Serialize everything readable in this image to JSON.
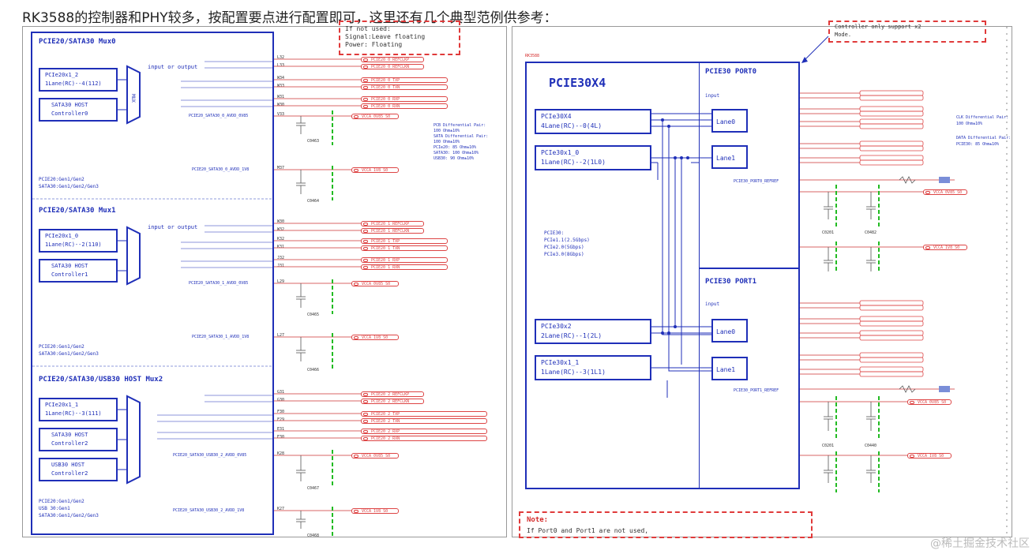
{
  "heading": "RK3588的控制器和PHY较多，按配置要点进行配置即可，这里还有几个典型范例供参考：",
  "watermark": "@稀土掘金技术社区",
  "left": {
    "note_lines": [
      "If not used:",
      "Signal:Leave floating",
      "Power: Floating"
    ],
    "mux0": {
      "title": "PCIE20/SATA30 Mux0",
      "io": "input or output",
      "ctrl_a": [
        "PCIe20x1_2",
        "1Lane(RC)--4(112)"
      ],
      "ctrl_b": [
        "SATA30 HOST",
        "Controller0"
      ],
      "mux_label": "MUX",
      "modes": [
        "PCIE20:Gen1/Gen2",
        "SATA30:Gen1/Gen2/Gen3"
      ],
      "pins": [
        "L32",
        "L33",
        "W34",
        "W33",
        "W31",
        "W30",
        "V33",
        "M37"
      ],
      "nets": [
        "PCIE20_0_REFCLKP",
        "PCIE20_0_REFCLKN",
        "PCIE20_0_TXP",
        "PCIE20_0_TXN",
        "PCIE20_0_RXP",
        "PCIE20_0_RXN"
      ],
      "power_nets": [
        "VCCA_0V85_S0",
        "VCCA_1V8_S0"
      ],
      "power_pins": [
        "PCIE20_SATA30_0_AVDD_0V85",
        "PCIE20_SATA30_0_AVDD_1V8"
      ],
      "caps": [
        "C0463",
        "C0464"
      ]
    },
    "mux1": {
      "title": "PCIE20/SATA30 Mux1",
      "io": "input or output",
      "ctrl_a": [
        "PCIe20x1_0",
        "1Lane(RC)--2(110)"
      ],
      "ctrl_b": [
        "SATA30 HOST",
        "Controller1"
      ],
      "mux_label": "MUX",
      "modes": [
        "PCIE20:Gen1/Gen2",
        "SATA30:Gen1/Gen2/Gen3"
      ],
      "pins": [
        "W30",
        "W32",
        "K32",
        "K31",
        "J32",
        "J31",
        "L29",
        "L27"
      ],
      "nets": [
        "PCIE20_1_REFCLKP",
        "PCIE20_1_REFCLKN",
        "PCIE20_1_TXP",
        "PCIE20_1_TXN",
        "PCIE20_1_RXP",
        "PCIE20_1_RXN"
      ],
      "power_nets": [
        "VCCA_0V85_S0",
        "VCCA_1V8_S0"
      ],
      "power_pins": [
        "PCIE20_SATA30_1_AVDD_0V85",
        "PCIE20_SATA30_1_AVDD_1V8"
      ],
      "caps": [
        "C0465",
        "C0466"
      ]
    },
    "mux2": {
      "title": "PCIE20/SATA30/USB30 HOST Mux2",
      "ctrl_a": [
        "PCIe20x1_1",
        "1Lane(RC)--3(111)"
      ],
      "ctrl_b": [
        "SATA30 HOST",
        "Controller2"
      ],
      "ctrl_c": [
        "USB30 HOST",
        "Controller2"
      ],
      "mux_label": "MUX",
      "modes": [
        "PCIE20:Gen1/Gen2",
        "USB 30:Gen1",
        "SATA30:Gen1/Gen2/Gen3"
      ],
      "pins": [
        "G31",
        "G30",
        "F30",
        "F29",
        "E31",
        "E30",
        "K28",
        "K27"
      ],
      "nets": [
        "PCIE20_2_REFCLKP",
        "PCIE20_2_REFCLKN",
        "PCIE20_2_TXP",
        "PCIE20_2_TXN",
        "PCIE20_2_RXP",
        "PCIE20_2_RXN"
      ],
      "power_nets": [
        "VCCA_0V85_S0",
        "VCCA_1V8_S0"
      ],
      "power_pins": [
        "PCIE20_SATA30_USB30_2_AVDD_0V85",
        "PCIE20_SATA30_USB30_2_AVDD_1V8"
      ],
      "caps": [
        "C0467",
        "C0468"
      ]
    },
    "side_note": [
      "PCB Differential Pair:",
      "100 Ohm±10%",
      "SATA Differential Pair:",
      "100 Ohm±10%",
      "PCIe20: 85 Ohm±10%",
      "SATA30: 100 Ohm±10%",
      "USB30: 90 Ohm±10%"
    ]
  },
  "right": {
    "top_note": [
      "Controller only support x2",
      "Mode."
    ],
    "block_title": "PCIE30X4",
    "port0_title": "PCIE30 PORT0",
    "port1_title": "PCIE30 PORT1",
    "ctrl0": [
      "PCIe30X4",
      "4Lane(RC)--0(4L)"
    ],
    "ctrl1": [
      "PCIe30x1_0",
      "1Lane(RC)--2(1L0)"
    ],
    "ctrl2": [
      "PCIe30x2",
      "2Lane(RC)--1(2L)"
    ],
    "ctrl3": [
      "PCIe30x1_1",
      "1Lane(RC)--3(1L1)"
    ],
    "lanes": [
      "Lane0",
      "Lane1",
      "Lane0",
      "Lane1"
    ],
    "speeds": [
      "PCIE30:",
      "PCIe1.1(2.5Gbps)",
      "PCIe2.0(5Gbps)",
      "PCIe3.0(8Gbps)"
    ],
    "input_label": "input",
    "refsel_nets": [
      "PCIE30_PORT0_REFREF",
      "PCIE30_PORT1_REFREF"
    ],
    "power_nets": [
      "VCCA_0V85_S0",
      "VCCA_1V8_S0",
      "VCCA_0V85_S0",
      "VCCA_1V8_S0"
    ],
    "caps": [
      "C0201",
      "C0482",
      "C0201",
      "C0440"
    ],
    "side_note": [
      "CLK Differential Pair:",
      "100 Ohm±10%",
      "DATA Differential Pair:",
      "PCIE30: 85 Ohm±10%"
    ],
    "bottom_note": [
      "Note:",
      "If Port0 and Port1 are not used,"
    ],
    "chip_label": "RK3588"
  }
}
